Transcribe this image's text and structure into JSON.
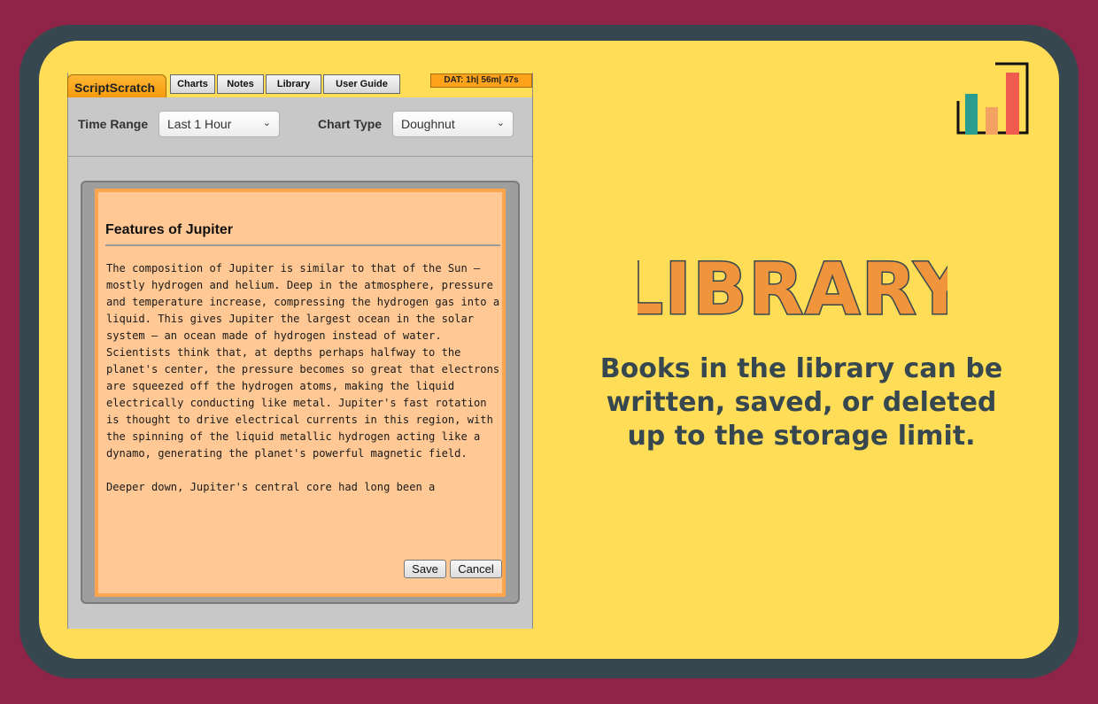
{
  "app": {
    "brand": "ScriptScratch",
    "tabs": [
      "Charts",
      "Notes",
      "Library",
      "User Guide"
    ],
    "timer": "DAT: 1h| 56m| 47s",
    "time_range": {
      "label": "Time Range",
      "selected": "Last 1 Hour"
    },
    "chart_type": {
      "label": "Chart Type",
      "selected": "Doughnut"
    }
  },
  "editor": {
    "title": "Features of Jupiter",
    "body": "The composition of Jupiter is similar to that of the Sun – mostly hydrogen and helium. Deep in the atmosphere, pressure and temperature increase, compressing the hydrogen gas into a liquid. This gives Jupiter the largest ocean in the solar system – an ocean made of hydrogen instead of water. Scientists think that, at depths perhaps halfway to the planet's center, the pressure becomes so great that electrons are squeezed off the hydrogen atoms, making the liquid electrically conducting like metal. Jupiter's fast rotation is thought to drive electrical currents in this region, with the spinning of the liquid metallic hydrogen acting like a dynamo, generating the planet's powerful magnetic field.\n\nDeeper down, Jupiter's central core had long been a",
    "save_label": "Save",
    "cancel_label": "Cancel"
  },
  "promo": {
    "heading": "LIBRARY",
    "description_lines": [
      "Books in the library can be",
      "written, saved, or deleted",
      "up to the storage limit."
    ]
  },
  "colors": {
    "background": "#8e2548",
    "frame": "#37474f",
    "card": "#ffdd57",
    "accent": "#f0953c",
    "bar_teal": "#2a9d8f",
    "bar_orange": "#f4a261",
    "bar_red": "#ef5b4c"
  },
  "icons": {
    "logo": "bar-chart-icon",
    "dropdown": "chevron-down-icon"
  }
}
